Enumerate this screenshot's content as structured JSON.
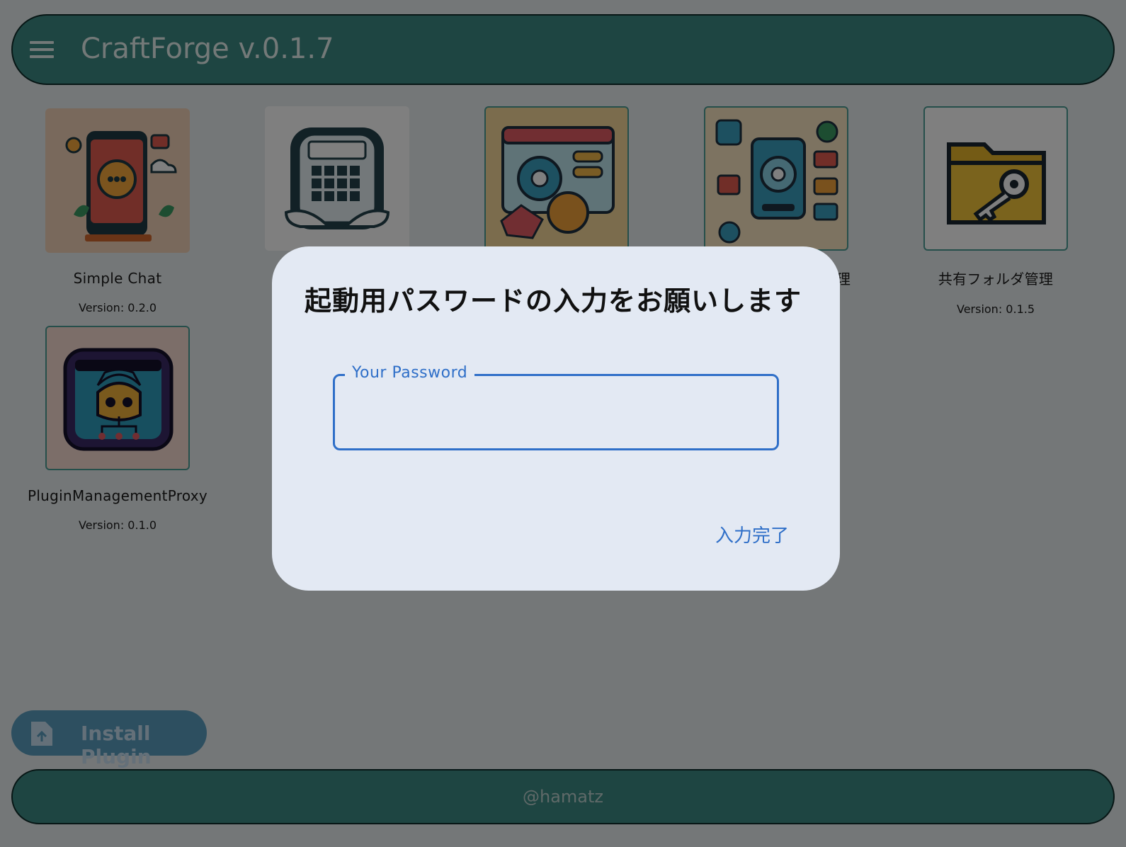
{
  "header": {
    "title": "CraftForge v.0.1.7",
    "menu_icon": "menu-icon"
  },
  "plugins": [
    {
      "name": "Simple Chat",
      "version": "Version: 0.2.0",
      "icon": "chat-app-icon"
    },
    {
      "name": "",
      "version": "",
      "icon": "calculator-icon"
    },
    {
      "name": "",
      "version": "",
      "icon": "settings-window-icon"
    },
    {
      "name": "理",
      "version": "",
      "icon": "app-settings-icon"
    },
    {
      "name": "共有フォルダ管理",
      "version": "Version: 0.1.5",
      "icon": "folder-key-icon"
    },
    {
      "name": "PluginManagementProxy",
      "version": "Version: 0.1.0",
      "icon": "robot-icon"
    }
  ],
  "dialog": {
    "title": "起動用パスワードの入力をお願いします",
    "field_label": "Your Password",
    "field_value": "",
    "confirm_label": "入力完了"
  },
  "fab": {
    "label": "Install Plugin",
    "icon": "upload-file-icon"
  },
  "footer": {
    "text": "@hamatz"
  },
  "colors": {
    "primary": "#3d8a85",
    "dialog_bg": "#e3e9f3",
    "accent": "#2f6fc8",
    "fab": "#5a9ec0"
  }
}
